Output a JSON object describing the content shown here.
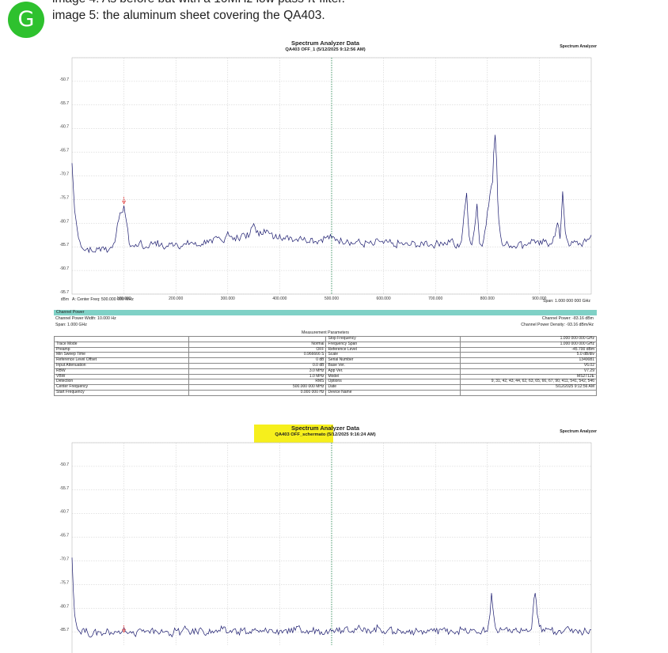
{
  "message": {
    "avatar_letter": "G",
    "line1": "image 4: As before but with a 10MHz low pass π filter.",
    "line2": "image 5: the aluminum sheet covering the QA403."
  },
  "analyzer1": {
    "title": "Spectrum Analyzer Data",
    "subtitle": "QA403 OFF_1 (5/12/2025 9:12:56 AM)",
    "brand": "Spectrum Analyzer",
    "center_label": "A: Center Freq: 500.000 000 MHz",
    "span_label": "Span: 1.000 000 000 GHz",
    "channel_power_title": "Channel Power",
    "channel_width": "Channel Power Width: 10.000 Hz",
    "span_short": "Span: 1.000 GHz",
    "channel_power_value": "Channel Power: -83.16 dBm",
    "channel_density": "Channel Power Density: -93.16 dBm/Hz",
    "params_title": "Measurement Parameters",
    "params": [
      [
        "",
        "",
        "Stop Frequency",
        "1.000 000 000 GHz"
      ],
      [
        "Trace Mode",
        "Normal",
        "Frequency Span",
        "1.000 000 000 GHz"
      ],
      [
        "Preamp",
        "OFF",
        "Reference Level",
        "-45.700  dBm"
      ],
      [
        "Min Sweep Time",
        "0.966666 S",
        "Scale",
        "5.0  dB/div"
      ],
      [
        "Reference Level Offset",
        "0 dB",
        "Serial Number",
        "1349081"
      ],
      [
        "Input Attenuation",
        "0.0 dB",
        "Base Ver.",
        "V6.02"
      ],
      [
        "RBW",
        "3.0 MHz",
        "App Ver.",
        "V7.29"
      ],
      [
        "VBW",
        "1.0 MHz",
        "Model",
        "MS2712E"
      ],
      [
        "Detection",
        "RMS",
        "Options",
        "9, 31, 42, 43, 44, 62, 63, 65, 66, 67, 90, 411, 541, 542, 546"
      ],
      [
        "Center Frequency",
        "500.000 000 MHz",
        "Date",
        "5/12/2025 9:12:56 AM"
      ],
      [
        "Start Frequency",
        "0.000 000 Hz",
        "Device Name",
        ""
      ]
    ]
  },
  "analyzer2": {
    "title": "Spectrum Analyzer Data",
    "subtitle": "QA403 OFF_schermato (5/12/2025 9:16:24 AM)",
    "brand": "Spectrum Analyzer",
    "highlight_color": "#f6ef1c"
  },
  "chart_data": [
    {
      "type": "line",
      "title": "Spectrum Analyzer Data",
      "subtitle": "QA403 OFF_1 (5/12/2025 9:12:56 AM)",
      "y_unit_label": "dBm",
      "y_ticks": [
        "-50.7",
        "-55.7",
        "-60.7",
        "-65.7",
        "-70.7",
        "-75.7",
        "-80.7",
        "-85.7",
        "-90.7",
        "-95.7"
      ],
      "x_ticks": [
        "100.000",
        "200.000",
        "300.000",
        "400.000",
        "500.000",
        "600.000",
        "700.000",
        "800.000",
        "900.000"
      ],
      "ylim": [
        -95.7,
        -45.7
      ],
      "xlim": [
        0,
        1000
      ],
      "marker": {
        "label": "1",
        "x": 100,
        "y": -76.5
      },
      "series": [
        {
          "color": "#1a1a6e",
          "x": [
            0,
            5,
            10,
            15,
            20,
            25,
            30,
            40,
            50,
            60,
            70,
            80,
            85,
            90,
            95,
            100,
            105,
            110,
            120,
            130,
            140,
            150,
            160,
            170,
            180,
            190,
            200,
            210,
            220,
            230,
            240,
            250,
            260,
            270,
            280,
            290,
            300,
            310,
            320,
            330,
            340,
            350,
            360,
            370,
            380,
            390,
            400,
            410,
            420,
            430,
            440,
            450,
            460,
            470,
            480,
            490,
            500,
            510,
            520,
            530,
            540,
            550,
            560,
            570,
            580,
            590,
            600,
            610,
            620,
            630,
            640,
            650,
            660,
            670,
            680,
            690,
            700,
            710,
            720,
            730,
            740,
            750,
            760,
            765,
            770,
            775,
            780,
            785,
            790,
            795,
            800,
            805,
            810,
            812,
            815,
            818,
            820,
            822,
            825,
            828,
            830,
            840,
            850,
            860,
            870,
            880,
            890,
            900,
            910,
            920,
            930,
            935,
            940,
            945,
            950,
            955,
            960,
            970,
            980,
            990,
            1000
          ],
          "y": [
            -68,
            -78,
            -82,
            -84.5,
            -86,
            -86.5,
            -86,
            -86.8,
            -86.2,
            -85.7,
            -86.5,
            -85,
            -83,
            -80,
            -78.5,
            -77,
            -80.5,
            -85,
            -85.7,
            -84.8,
            -86,
            -85.2,
            -84.6,
            -85.4,
            -85.9,
            -85.1,
            -84.9,
            -85.6,
            -85.2,
            -84.7,
            -85.5,
            -85.1,
            -84.3,
            -84.9,
            -83.8,
            -84.6,
            -82.5,
            -84.2,
            -83.9,
            -82.8,
            -83.7,
            -80.8,
            -83.4,
            -82,
            -82.9,
            -83.8,
            -83.1,
            -84.1,
            -83.6,
            -84.2,
            -83.5,
            -84.4,
            -83.9,
            -84.6,
            -84.1,
            -83.7,
            -83.8,
            -84.1,
            -84.6,
            -84.2,
            -85.1,
            -84.5,
            -85.3,
            -84.8,
            -85.4,
            -84.3,
            -85,
            -84.7,
            -85.6,
            -84.9,
            -85.2,
            -85.4,
            -84.8,
            -85.7,
            -84.6,
            -85.3,
            -85.2,
            -84.7,
            -85.1,
            -84.2,
            -86,
            -84.5,
            -74.3,
            -83.5,
            -85.3,
            -82,
            -76.6,
            -85,
            -85.6,
            -82.5,
            -78.2,
            -74.5,
            -72,
            -66,
            -62,
            -68,
            -76,
            -80,
            -83,
            -85,
            -85.5,
            -85.1,
            -85.6,
            -84.9,
            -85.4,
            -84.8,
            -84.2,
            -85.3,
            -84.6,
            -85.1,
            -83.5,
            -80.6,
            -84,
            -74,
            -82.5,
            -84.6,
            -85.4,
            -84.7,
            -85.2,
            -84.6,
            -83.2
          ]
        }
      ]
    },
    {
      "type": "line",
      "title": "Spectrum Analyzer Data",
      "subtitle": "QA403 OFF_schermato (5/12/2025 9:16:24 AM)",
      "y_ticks": [
        "-50.7",
        "-55.7",
        "-60.7",
        "-65.7",
        "-70.7",
        "-75.7",
        "-80.7",
        "-85.7"
      ],
      "ylim": [
        -95.7,
        -45.7
      ],
      "xlim": [
        0,
        1000
      ],
      "marker": {
        "label": "1",
        "x": 100,
        "y": -85.7
      },
      "series": [
        {
          "color": "#1a1a6e",
          "x": [
            0,
            5,
            10,
            15,
            20,
            30,
            40,
            50,
            60,
            70,
            80,
            90,
            100,
            110,
            120,
            130,
            140,
            150,
            160,
            170,
            180,
            190,
            200,
            210,
            220,
            230,
            240,
            250,
            260,
            270,
            280,
            290,
            300,
            310,
            320,
            330,
            340,
            350,
            360,
            370,
            380,
            390,
            400,
            410,
            420,
            430,
            440,
            450,
            460,
            470,
            480,
            490,
            500,
            510,
            520,
            530,
            540,
            550,
            560,
            570,
            580,
            590,
            600,
            610,
            620,
            630,
            640,
            650,
            660,
            670,
            680,
            690,
            700,
            710,
            720,
            730,
            740,
            750,
            760,
            770,
            780,
            790,
            800,
            805,
            808,
            812,
            816,
            820,
            830,
            840,
            850,
            860,
            870,
            880,
            885,
            888,
            892,
            896,
            900,
            910,
            920,
            930,
            940,
            950,
            960,
            970,
            980,
            990,
            1000
          ],
          "y": [
            -70,
            -82,
            -85,
            -85.7,
            -85.2,
            -85.9,
            -86.3,
            -85.6,
            -86.1,
            -85.4,
            -86.2,
            -85.5,
            -84.8,
            -85.9,
            -86.3,
            -85.1,
            -85.8,
            -86,
            -85.3,
            -85.9,
            -85.6,
            -86.2,
            -85.4,
            -85.8,
            -85.1,
            -85.9,
            -85.6,
            -85.2,
            -86,
            -85.5,
            -85.8,
            -85.1,
            -85.9,
            -85.3,
            -85.7,
            -85.2,
            -86.1,
            -85.4,
            -85.8,
            -85.6,
            -85.2,
            -85.9,
            -85.5,
            -85.3,
            -85.8,
            -85.4,
            -85.1,
            -85.9,
            -85.6,
            -85.2,
            -85.7,
            -85.3,
            -85.6,
            -84.9,
            -85.4,
            -84.6,
            -85.5,
            -84.9,
            -85.6,
            -85.1,
            -85.5,
            -84.8,
            -85.6,
            -85.2,
            -85.7,
            -85.4,
            -86,
            -85.3,
            -85.8,
            -85.5,
            -85.9,
            -85.2,
            -85.7,
            -85.1,
            -85.6,
            -85.3,
            -85.7,
            -85.2,
            -85.8,
            -85.4,
            -86,
            -85.4,
            -85.6,
            -82,
            -77.5,
            -82,
            -85,
            -85.9,
            -85.3,
            -85.6,
            -85.2,
            -85.7,
            -85.3,
            -85.6,
            -85.1,
            -81,
            -77.5,
            -82,
            -84.6,
            -85.6,
            -85.2,
            -85.7,
            -85.4,
            -85.1,
            -85.6,
            -85.2,
            -85.7,
            -85.5,
            -85.3
          ]
        }
      ]
    }
  ]
}
